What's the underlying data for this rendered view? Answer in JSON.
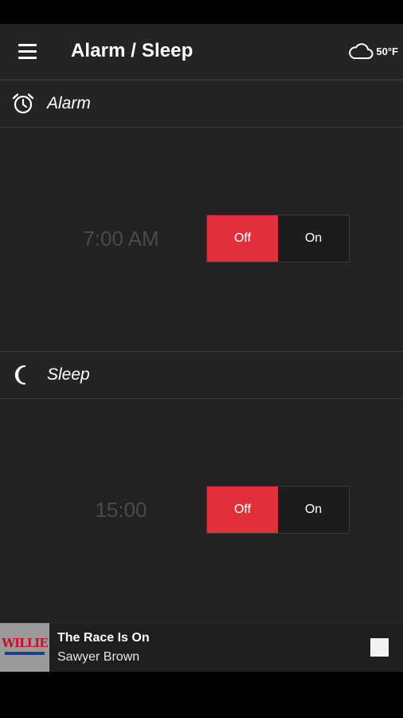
{
  "toolbar": {
    "title": "Alarm / Sleep",
    "menu_icon": "hamburger-menu-icon",
    "weather": {
      "icon": "cloud-icon",
      "temperature": "50°F"
    }
  },
  "sections": {
    "alarm": {
      "label": "Alarm",
      "icon": "alarm-clock-icon",
      "time": "7:00 AM",
      "toggle": {
        "off_label": "Off",
        "on_label": "On",
        "selected": "Off"
      }
    },
    "sleep": {
      "label": "Sleep",
      "icon": "moon-icon",
      "time": "15:00",
      "toggle": {
        "off_label": "Off",
        "on_label": "On",
        "selected": "Off"
      }
    }
  },
  "player": {
    "title": "The Race Is On",
    "artist": "Sawyer Brown",
    "station_logo_text": "WILLIE",
    "stop_icon": "stop-icon"
  },
  "colors": {
    "accent": "#e2303a",
    "background": "#222222",
    "inactive_time": "#4a4a4a"
  }
}
